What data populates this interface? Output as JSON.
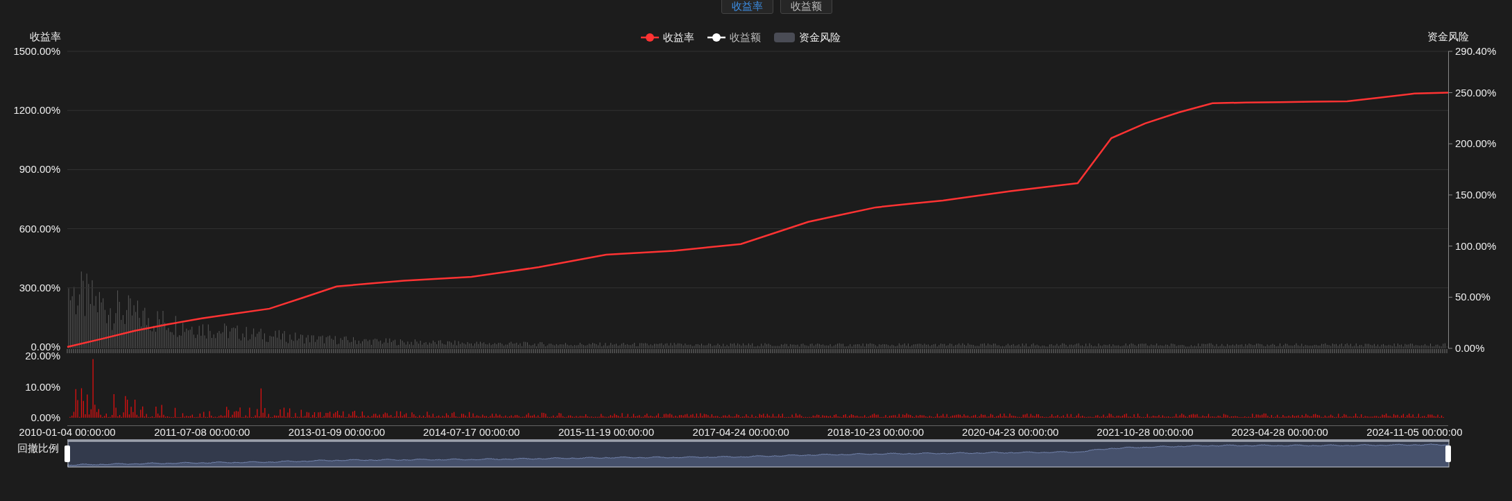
{
  "view_tabs": [
    {
      "label": "收益率",
      "selected": true
    },
    {
      "label": "收益额",
      "selected": false
    }
  ],
  "legend": [
    {
      "kind": "series"
    },
    {
      "kind": "line",
      "label": "收益额",
      "color": "#ffffff"
    },
    {
      "kind": "bar",
      "label": "资金风险",
      "color": "#4a4c55"
    }
  ],
  "main_chart": {
    "left_axis_title": "收益率",
    "right_axis_title": "资金风险",
    "right_yticks": [
      "290.40%",
      "250.00%",
      "200.00%",
      "150.00%",
      "100.00%",
      "50.00%",
      "0.00%"
    ],
    "chart_data": {
      "type": "line",
      "grid": true,
      "ylim": [
        0,
        1500
      ],
      "categories": [
        "2010-01-04 00:00:00",
        null,
        null,
        null,
        "2011-07-08 00:00:00",
        null,
        null,
        null,
        "2013-01-09 00:00:00",
        null,
        null,
        null,
        "2014-07-17 00:00:00",
        null,
        null,
        null,
        "2015-11-19 00:00:00",
        null,
        null,
        null,
        "2017-04-24 00:00:00",
        null,
        null,
        null,
        "2018-10-23 00:00:00",
        null,
        null,
        null,
        "2020-04-23 00:00:00",
        null,
        null,
        null,
        "2021-10-28 00:00:00",
        null,
        null,
        null,
        "2023-04-28 00:00:00",
        null,
        null,
        null,
        "2024-11-05 00:00:00",
        null
      ],
      "series": [
        {
          "name": "收益率",
          "color": "#ff3333",
          "values": [
            0,
            40,
            82,
            115,
            145,
            170,
            194,
            250,
            307,
            322,
            336,
            346,
            356,
            380,
            405,
            437,
            468,
            478,
            488,
            505,
            522,
            578,
            635,
            672,
            708,
            726,
            743,
            767,
            791,
            811,
            831,
            1060,
            1134,
            1190,
            1237,
            1240,
            1242,
            1245,
            1247,
            1266,
            1286,
            1290
          ]
        }
      ],
      "yticks": [
        {
          "value": 0,
          "label": "0.00%"
        },
        {
          "value": 300,
          "label": "300.00%"
        },
        {
          "value": 600,
          "label": "600.00%"
        },
        {
          "value": 900,
          "label": "900.00%"
        },
        {
          "value": 1200,
          "label": "1200.00%"
        },
        {
          "value": 1500,
          "label": "1500.00%"
        }
      ]
    }
  },
  "drawdown_chart": {
    "title": "回撤比例",
    "yticks": [
      "20.00%",
      "10.00%",
      "0.00%"
    ]
  },
  "zoom_slider": {
    "handles": [
      {
        "level": 0
      },
      {
        "level": 1
      }
    ]
  }
}
